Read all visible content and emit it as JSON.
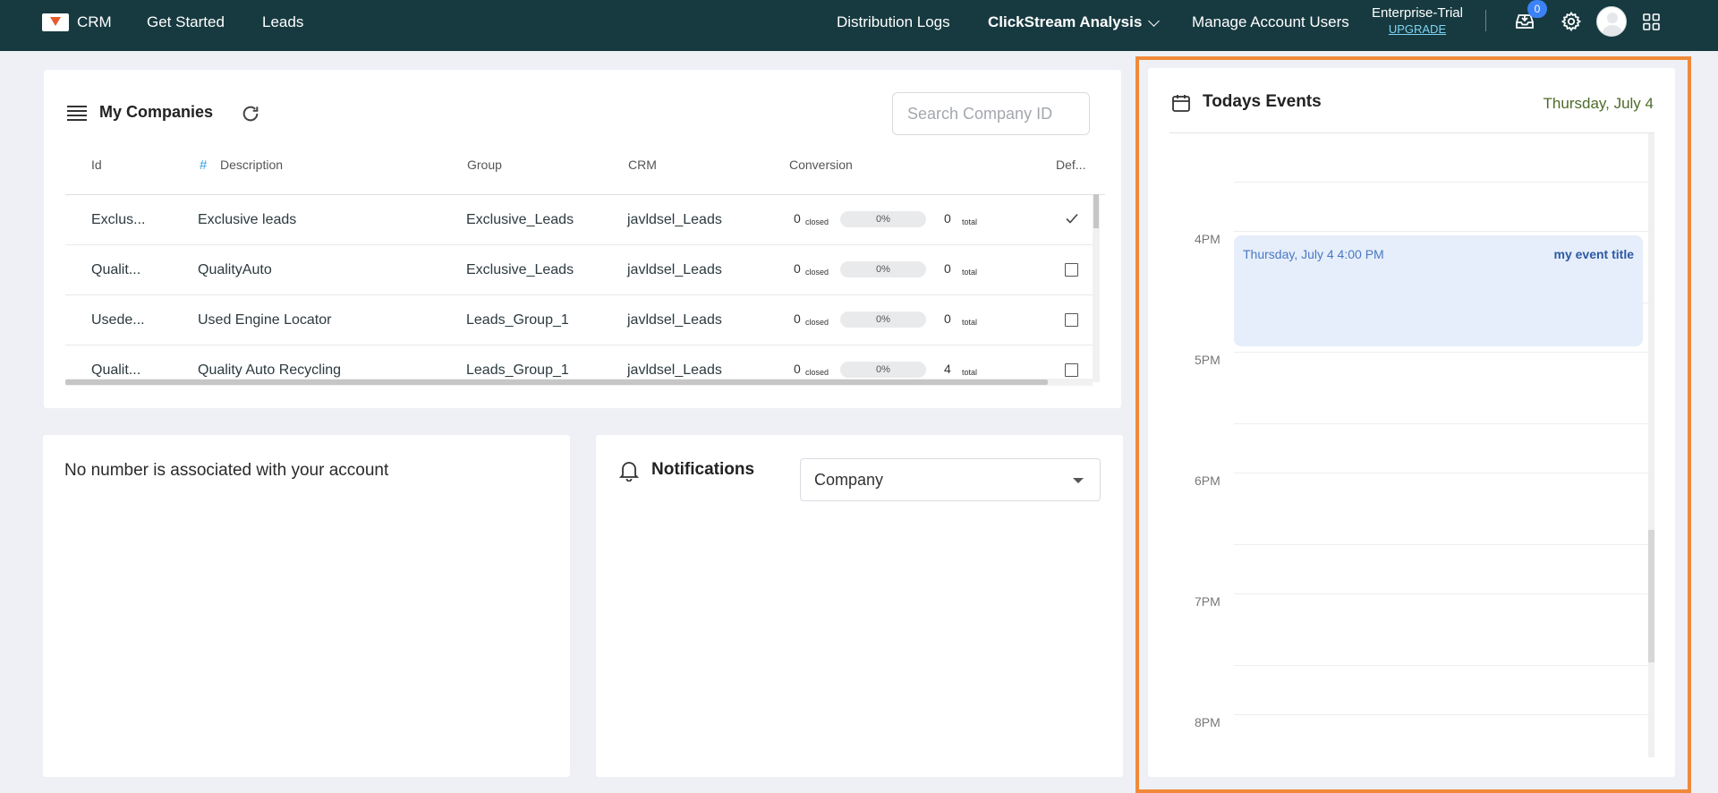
{
  "nav": {
    "brand": "CRM",
    "get_started": "Get Started",
    "leads": "Leads",
    "distribution_logs": "Distribution Logs",
    "clickstream": "ClickStream Analysis",
    "manage_users": "Manage Account Users",
    "plan": "Enterprise-Trial",
    "upgrade": "UPGRADE",
    "inbox_count": "0",
    "bg_color": "#173a40"
  },
  "companies": {
    "title": "My Companies",
    "search_placeholder": "Search Company ID",
    "headers": {
      "id": "Id",
      "hash": "#",
      "description": "Description",
      "group": "Group",
      "crm": "CRM",
      "conversion": "Conversion",
      "default": "Def..."
    },
    "rows": [
      {
        "id": "Exclus...",
        "description": "Exclusive leads",
        "group": "Exclusive_Leads",
        "crm": "javldsel_Leads",
        "closed": "0",
        "closed_label": "closed",
        "percent": "0%",
        "total": "0",
        "total_label": "total",
        "default": "checked"
      },
      {
        "id": "Qualit...",
        "description": "QualityAuto",
        "group": "Exclusive_Leads",
        "crm": "javldsel_Leads",
        "closed": "0",
        "closed_label": "closed",
        "percent": "0%",
        "total": "0",
        "total_label": "total",
        "default": "unchecked"
      },
      {
        "id": "Usede...",
        "description": "Used Engine Locator",
        "group": "Leads_Group_1",
        "crm": "javldsel_Leads",
        "closed": "0",
        "closed_label": "closed",
        "percent": "0%",
        "total": "0",
        "total_label": "total",
        "default": "unchecked"
      },
      {
        "id": "Qualit...",
        "description": "Quality Auto Recycling",
        "group": "Leads_Group_1",
        "crm": "javldsel_Leads",
        "closed": "0",
        "closed_label": "closed",
        "percent": "0%",
        "total": "4",
        "total_label": "total",
        "default": "unchecked"
      }
    ]
  },
  "phone": {
    "message": "No number is associated with your account"
  },
  "notifications": {
    "title": "Notifications",
    "filter_value": "Company"
  },
  "events": {
    "title": "Todays Events",
    "date": "Thursday, July 4",
    "hours": [
      "4PM",
      "5PM",
      "6PM",
      "7PM",
      "8PM"
    ],
    "event": {
      "time": "Thursday, July 4 4:00 PM",
      "name": "my event title"
    },
    "highlight_color": "#f08a3a"
  }
}
